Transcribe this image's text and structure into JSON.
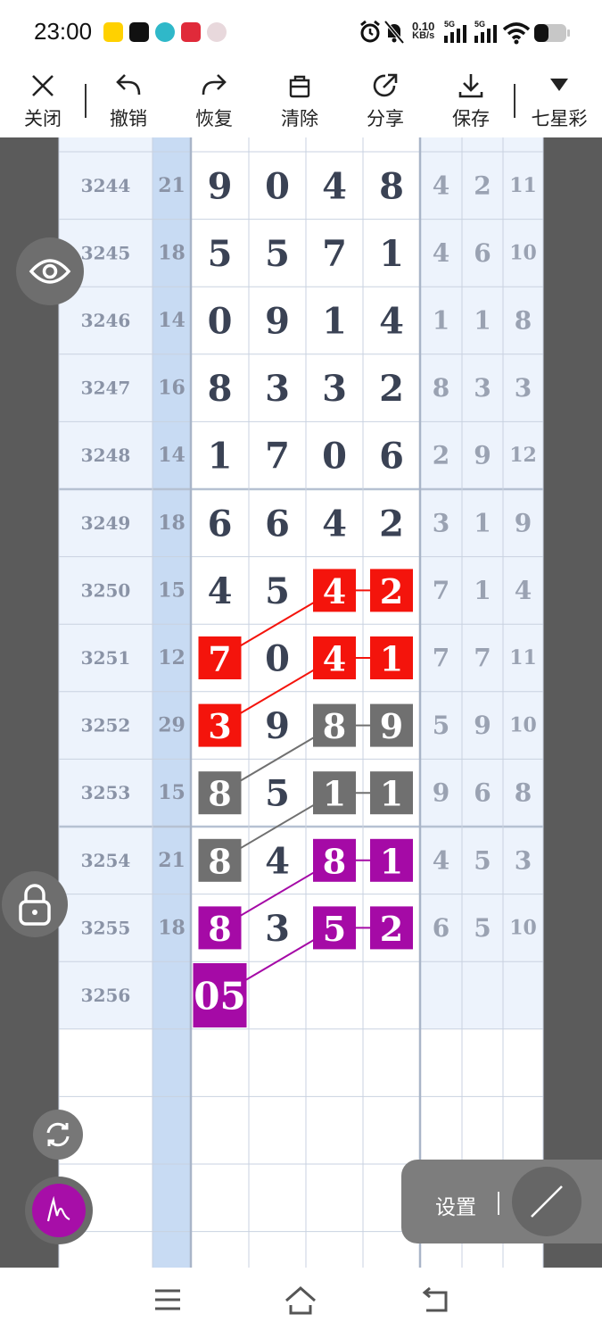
{
  "status_bar": {
    "time": "23:00",
    "app_icons": [
      "meituan-icon",
      "tiktok-icon",
      "app-icon",
      "heart-app-icon",
      "avatar-app-icon"
    ],
    "net_speed_value": "0.10",
    "net_speed_unit": "KB/s",
    "signal_labels": [
      "5G",
      "5G"
    ],
    "icons": [
      "alarm-icon",
      "mute-icon",
      "signal-icon",
      "wifi-icon",
      "battery-icon"
    ]
  },
  "toolbar": {
    "close_label": "关闭",
    "undo_label": "撤销",
    "redo_label": "恢复",
    "clear_label": "清除",
    "share_label": "分享",
    "save_label": "保存",
    "lottery_label": "七星彩"
  },
  "grid": {
    "rows": [
      {
        "issue": "3244",
        "sum": "21",
        "digits": [
          "9",
          "0",
          "4",
          "8"
        ],
        "stats": [
          "4",
          "2",
          "11"
        ]
      },
      {
        "issue": "3245",
        "sum": "18",
        "digits": [
          "5",
          "5",
          "7",
          "1"
        ],
        "stats": [
          "4",
          "6",
          "10"
        ]
      },
      {
        "issue": "3246",
        "sum": "14",
        "digits": [
          "0",
          "9",
          "1",
          "4"
        ],
        "stats": [
          "1",
          "1",
          "8"
        ]
      },
      {
        "issue": "3247",
        "sum": "16",
        "digits": [
          "8",
          "3",
          "3",
          "2"
        ],
        "stats": [
          "8",
          "3",
          "3"
        ]
      },
      {
        "issue": "3248",
        "sum": "14",
        "digits": [
          "1",
          "7",
          "0",
          "6"
        ],
        "stats": [
          "2",
          "9",
          "12"
        ]
      },
      {
        "issue": "3249",
        "sum": "18",
        "digits": [
          "6",
          "6",
          "4",
          "2"
        ],
        "stats": [
          "3",
          "1",
          "9"
        ]
      },
      {
        "issue": "3250",
        "sum": "15",
        "digits": [
          "4",
          "5",
          "4",
          "2"
        ],
        "stats": [
          "7",
          "1",
          "4"
        ]
      },
      {
        "issue": "3251",
        "sum": "12",
        "digits": [
          "7",
          "0",
          "4",
          "1"
        ],
        "stats": [
          "7",
          "7",
          "11"
        ]
      },
      {
        "issue": "3252",
        "sum": "29",
        "digits": [
          "3",
          "9",
          "8",
          "9"
        ],
        "stats": [
          "5",
          "9",
          "10"
        ]
      },
      {
        "issue": "3253",
        "sum": "15",
        "digits": [
          "8",
          "5",
          "1",
          "1"
        ],
        "stats": [
          "9",
          "6",
          "8"
        ]
      },
      {
        "issue": "3254",
        "sum": "21",
        "digits": [
          "8",
          "4",
          "8",
          "1"
        ],
        "stats": [
          "4",
          "5",
          "3"
        ]
      },
      {
        "issue": "3255",
        "sum": "18",
        "digits": [
          "8",
          "3",
          "5",
          "2"
        ],
        "stats": [
          "6",
          "5",
          "10"
        ]
      },
      {
        "issue": "3256",
        "sum": "",
        "digits": [
          "05",
          "",
          "",
          ""
        ],
        "stats": [
          "",
          "",
          ""
        ]
      }
    ],
    "highlight_colors": {
      "red": "#f4140c",
      "gray": "#707070",
      "purple": "#a50aa6"
    },
    "highlights": [
      {
        "row": 6,
        "col": 2,
        "color": "red"
      },
      {
        "row": 6,
        "col": 3,
        "color": "red"
      },
      {
        "row": 7,
        "col": 0,
        "color": "red"
      },
      {
        "row": 7,
        "col": 2,
        "color": "red"
      },
      {
        "row": 7,
        "col": 3,
        "color": "red"
      },
      {
        "row": 8,
        "col": 0,
        "color": "red"
      },
      {
        "row": 8,
        "col": 2,
        "color": "gray"
      },
      {
        "row": 8,
        "col": 3,
        "color": "gray"
      },
      {
        "row": 9,
        "col": 0,
        "color": "gray"
      },
      {
        "row": 9,
        "col": 2,
        "color": "gray"
      },
      {
        "row": 9,
        "col": 3,
        "color": "gray"
      },
      {
        "row": 10,
        "col": 0,
        "color": "gray"
      },
      {
        "row": 10,
        "col": 2,
        "color": "purple"
      },
      {
        "row": 10,
        "col": 3,
        "color": "purple"
      },
      {
        "row": 11,
        "col": 0,
        "color": "purple"
      },
      {
        "row": 11,
        "col": 2,
        "color": "purple"
      },
      {
        "row": 11,
        "col": 3,
        "color": "purple"
      },
      {
        "row": 12,
        "col": 0,
        "color": "purple"
      }
    ],
    "connectors": [
      {
        "from_row": 6,
        "from_col": 2,
        "to_row": 6,
        "to_col": 3,
        "color": "red"
      },
      {
        "from_row": 7,
        "from_col": 2,
        "to_row": 7,
        "to_col": 3,
        "color": "red"
      },
      {
        "from_row": 8,
        "from_col": 2,
        "to_row": 8,
        "to_col": 3,
        "color": "gray"
      },
      {
        "from_row": 9,
        "from_col": 2,
        "to_row": 9,
        "to_col": 3,
        "color": "gray"
      },
      {
        "from_row": 10,
        "from_col": 2,
        "to_row": 10,
        "to_col": 3,
        "color": "purple"
      },
      {
        "from_row": 11,
        "from_col": 2,
        "to_row": 11,
        "to_col": 3,
        "color": "purple"
      },
      {
        "from_row": 6,
        "from_col": 2,
        "to_row": 7,
        "to_col": 0,
        "color": "red"
      },
      {
        "from_row": 7,
        "from_col": 2,
        "to_row": 8,
        "to_col": 0,
        "color": "red"
      },
      {
        "from_row": 8,
        "from_col": 2,
        "to_row": 9,
        "to_col": 0,
        "color": "gray"
      },
      {
        "from_row": 9,
        "from_col": 2,
        "to_row": 10,
        "to_col": 0,
        "color": "gray"
      },
      {
        "from_row": 10,
        "from_col": 2,
        "to_row": 11,
        "to_col": 0,
        "color": "purple"
      },
      {
        "from_row": 11,
        "from_col": 2,
        "to_row": 12,
        "to_col": 0,
        "color": "purple"
      }
    ],
    "colors": {
      "issue_text": "#8a93a6",
      "digit_text": "#3a4254",
      "stat_text": "#9aa2b2",
      "sum_column_bg": "#c8dbf3",
      "row_bg_light": "#edf3fc",
      "grid_line": "#c9d2e0"
    }
  },
  "controls": {
    "settings_label": "设置",
    "icons": [
      "eye-icon",
      "lock-icon",
      "sync-icon",
      "pen-icon",
      "line-tool-icon"
    ]
  },
  "nav_bar": {
    "icons": [
      "menu-icon",
      "home-icon",
      "back-icon"
    ]
  }
}
